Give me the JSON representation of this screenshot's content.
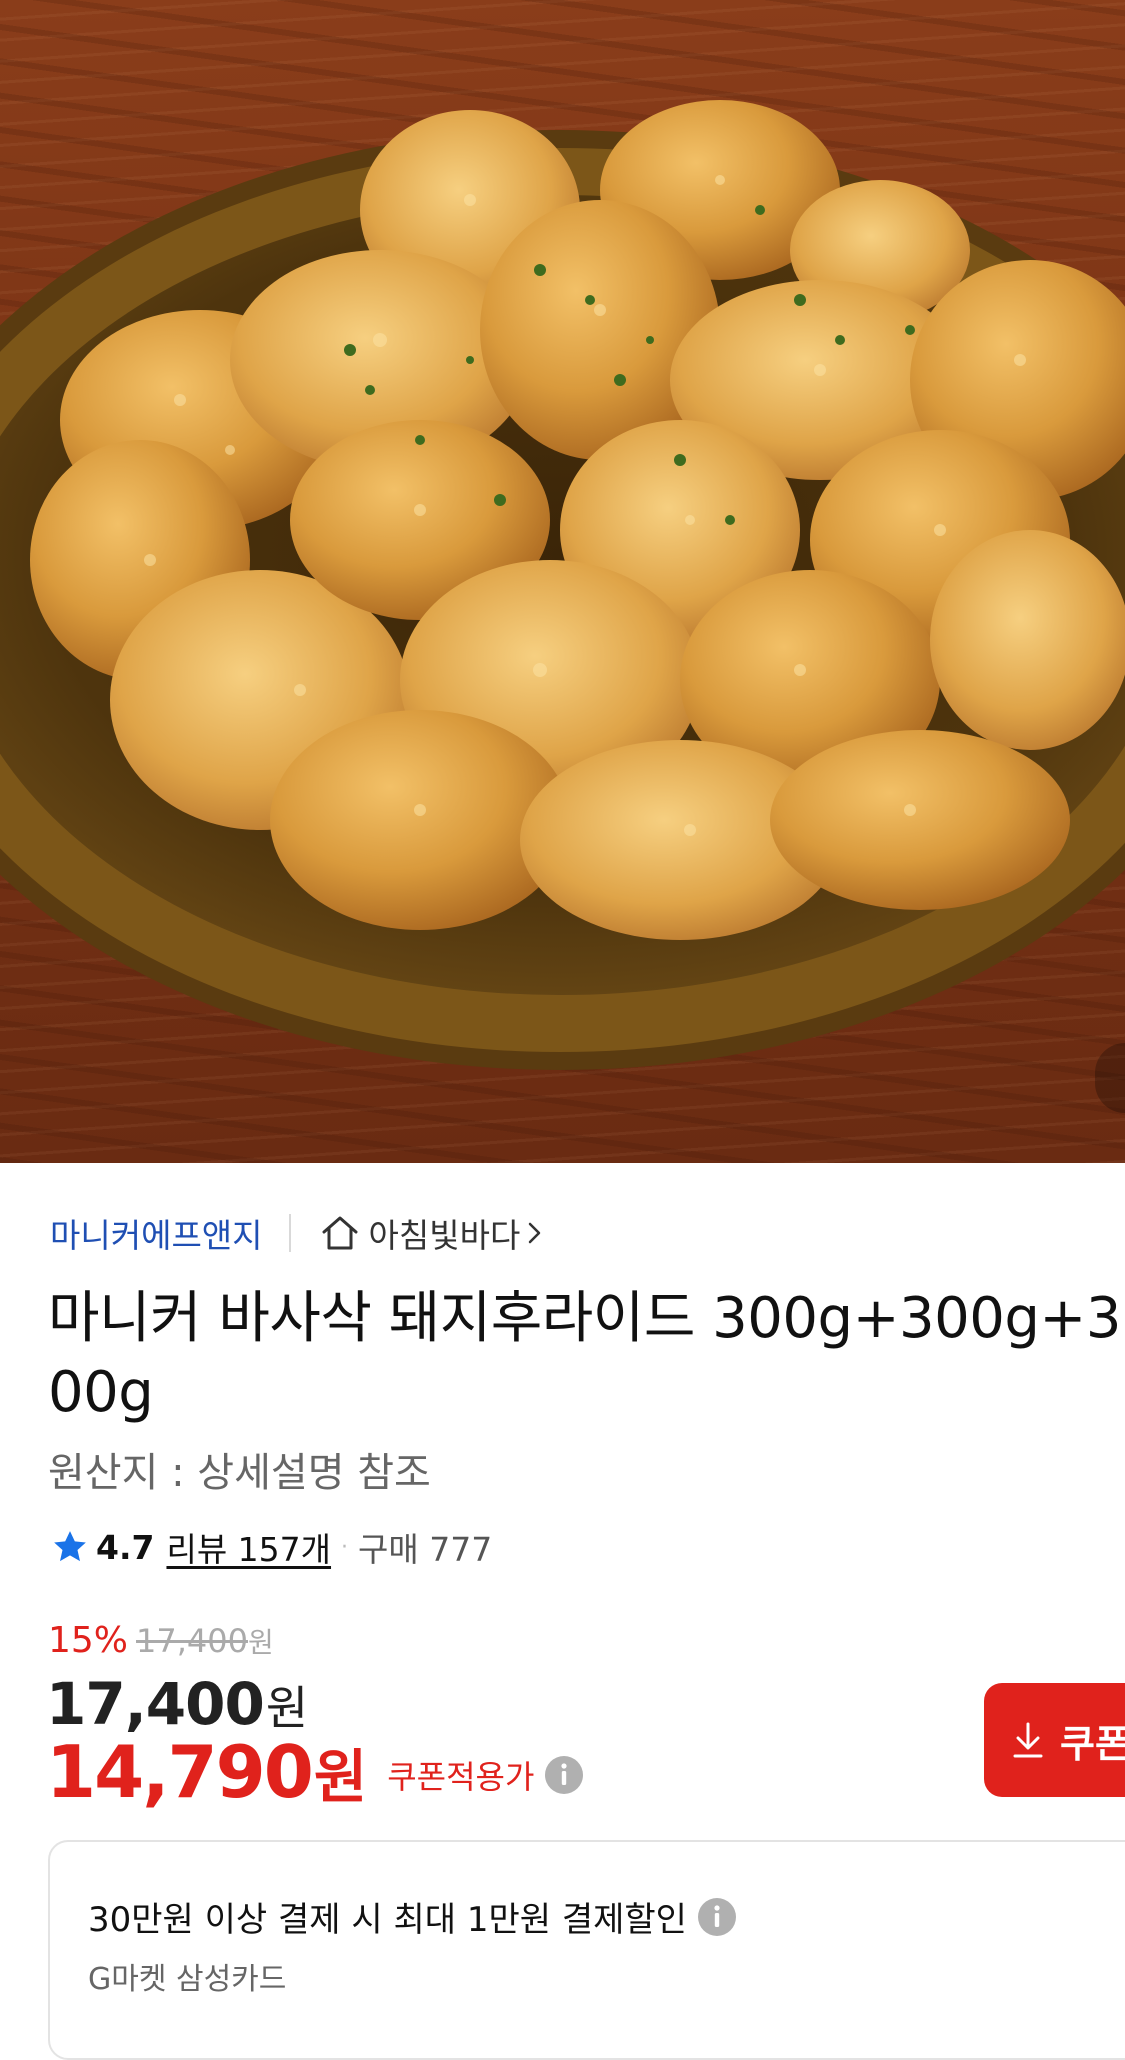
{
  "product_image": {
    "alt": "fried pork on wooden plate"
  },
  "store": {
    "brand": "마니커에프앤지",
    "name": "아침빛바다"
  },
  "product": {
    "title": "마니커 바사삭 돼지후라이드 300g+300g+300g",
    "origin": "원산지 : 상세설명 참조"
  },
  "rating": {
    "score": "4.7",
    "review_link": "리뷰 157개",
    "separator": "·",
    "purchase": "구매 777"
  },
  "price": {
    "discount_rate": "15%",
    "original": "17,400",
    "original_unit": "원",
    "price": "17,400",
    "price_unit": "원",
    "coupon_price": "14,790",
    "coupon_unit": "원",
    "coupon_label": "쿠폰적용가"
  },
  "coupon_button": {
    "label": "쿠폰"
  },
  "card_promo": {
    "title": "30만원 이상 결제 시 최대 1만원 결제할인",
    "subtitle": "G마켓 삼성카드"
  },
  "colors": {
    "accent_red": "#e0221c",
    "brand_blue": "#1f4fb3"
  }
}
